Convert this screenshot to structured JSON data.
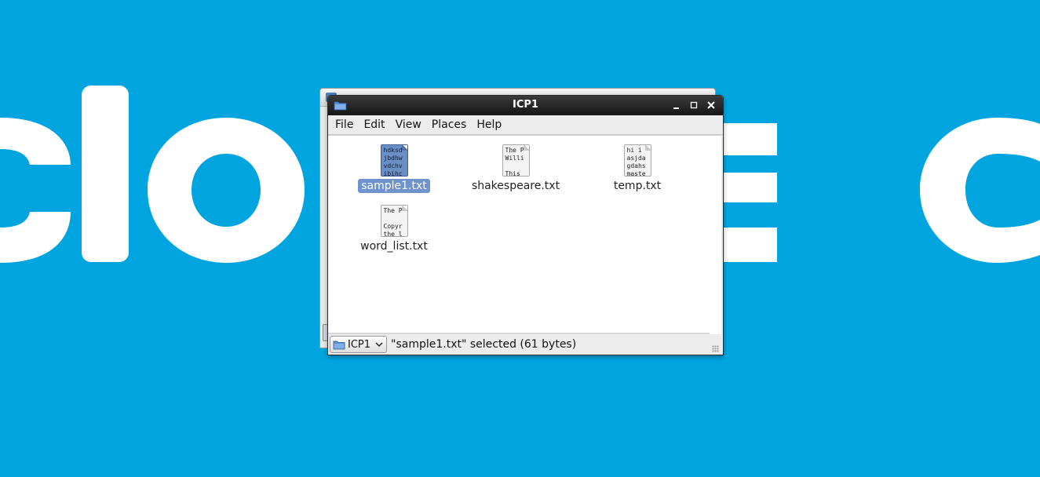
{
  "wallpaper": {
    "text_left": "clo",
    "text_mid": "e",
    "text_right": "c"
  },
  "window": {
    "title": "ICP1",
    "icon": "folder-icon",
    "controls": {
      "minimize": "minimize-icon",
      "maximize": "maximize-icon",
      "close": "close-icon"
    }
  },
  "menubar": {
    "items": [
      {
        "label": "File"
      },
      {
        "label": "Edit"
      },
      {
        "label": "View"
      },
      {
        "label": "Places"
      },
      {
        "label": "Help"
      }
    ]
  },
  "files": [
    {
      "name": "sample1.txt",
      "selected": true,
      "preview": "hdksd\njbdhw\nvdchv\nibihc"
    },
    {
      "name": "shakespeare.txt",
      "selected": false,
      "preview": "The P\nWilli\n\nThis"
    },
    {
      "name": "temp.txt",
      "selected": false,
      "preview": "hi i\nasjda\ngdahs\nmaste"
    },
    {
      "name": "word_list.txt",
      "selected": false,
      "preview": "The P\n\nCopyr\nthe l"
    }
  ],
  "statusbar": {
    "location": "ICP1",
    "status": "\"sample1.txt\" selected (61 bytes)"
  },
  "colors": {
    "desktop": "#00a4df",
    "selection": "#6f93cd"
  }
}
